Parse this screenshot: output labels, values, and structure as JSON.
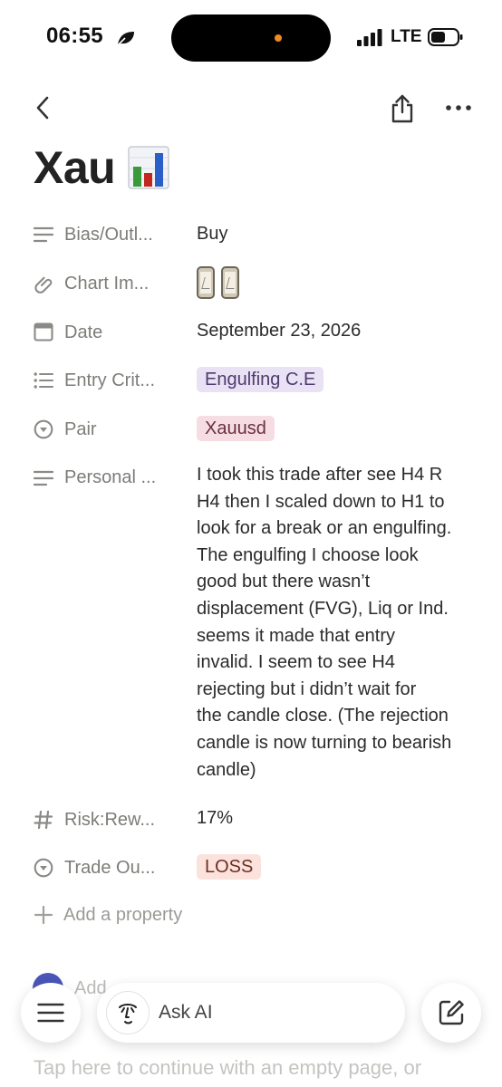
{
  "status": {
    "time": "06:55",
    "network": "LTE",
    "icons": [
      "leaf-icon",
      "signal-icon",
      "battery-icon"
    ]
  },
  "nav": {
    "icons": [
      "back-chevron-icon",
      "share-icon",
      "more-icon"
    ]
  },
  "page": {
    "title": "Xau",
    "title_icon": "bar-chart-emoji"
  },
  "properties": [
    {
      "name": "Bias/Outl...",
      "icon": "text-lines-icon",
      "value": "Buy"
    },
    {
      "name": "Chart Im...",
      "icon": "paperclip-icon",
      "value_type": "image-thumbnails",
      "thumbnail_count": 2
    },
    {
      "name": "Date",
      "icon": "calendar-icon",
      "value": "September 23, 2026"
    },
    {
      "name": "Entry Crit...",
      "icon": "bulleted-list-icon",
      "value": "Engulfing C.E",
      "tag_color": "#e9e1f4"
    },
    {
      "name": "Pair",
      "icon": "select-circle-icon",
      "value": "Xauusd",
      "tag_color": "#f6dde4"
    },
    {
      "name": "Personal ...",
      "icon": "text-lines-icon",
      "lines": [
        "I took this trade after see H4 R",
        "H4 then I scaled down to H1 to",
        "look for a break or an engulfing.",
        "The engulfing I choose look",
        "good but there wasn’t",
        "displacement (FVG), Liq or Ind.",
        "seems it made that entry",
        "invalid. I seem to see H4",
        "rejecting but i didn’t wait for",
        "the candle close. (The rejection",
        "candle is now turning to bearish",
        "candle)"
      ]
    },
    {
      "name": "Risk:Rew...",
      "icon": "hash-icon",
      "value": "17%"
    },
    {
      "name": "Trade Ou...",
      "icon": "select-circle-icon",
      "value": "LOSS",
      "tag_color": "#fbe2dc"
    }
  ],
  "add_property": {
    "label": "Add a property",
    "icon": "plus-icon"
  },
  "comment": {
    "placeholder": "Add"
  },
  "toolbar": {
    "menu_icon": "hamburger-icon",
    "ask_ai_label": "Ask AI",
    "ai_icon": "ai-face-icon",
    "edit_icon": "compose-icon"
  },
  "empty_hint": "Tap here to continue with an empty page, or"
}
